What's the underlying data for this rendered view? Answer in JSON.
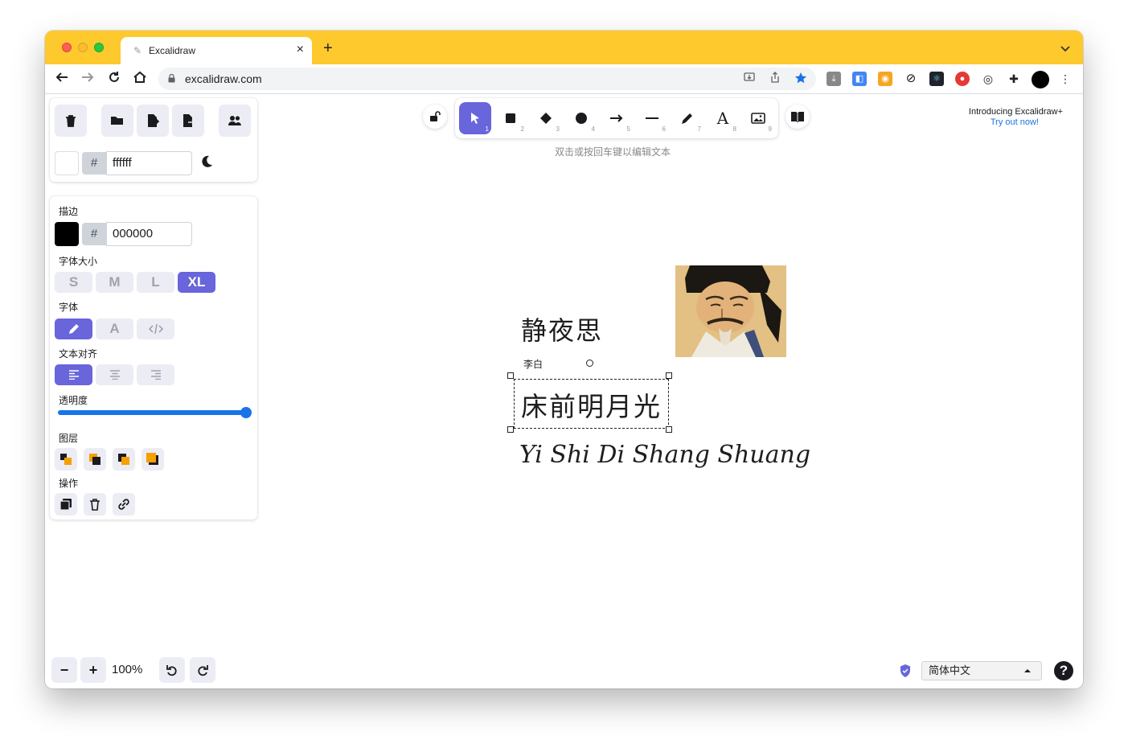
{
  "browser": {
    "tab_title": "Excalidraw",
    "url": "excalidraw.com",
    "tab_bar_color": "#fec92c"
  },
  "left_panel": {
    "background_hex": "ffffff",
    "hash": "#",
    "theme_icon": "moon-icon",
    "stroke": {
      "label": "描边",
      "hex": "000000"
    },
    "font_size": {
      "label": "字体大小",
      "options": [
        "S",
        "M",
        "L",
        "XL"
      ],
      "selected": "XL"
    },
    "font_family": {
      "label": "字体",
      "options": [
        "hand-drawn",
        "A",
        "code"
      ],
      "selected": "hand-drawn"
    },
    "text_align": {
      "label": "文本对齐",
      "selected": "left"
    },
    "opacity": {
      "label": "透明度",
      "value": 100
    },
    "layers": {
      "label": "图层"
    },
    "actions": {
      "label": "操作"
    }
  },
  "toolbar": {
    "tools": [
      {
        "name": "lock",
        "num": ""
      },
      {
        "name": "selection",
        "num": "1"
      },
      {
        "name": "rectangle",
        "num": "2"
      },
      {
        "name": "diamond",
        "num": "3"
      },
      {
        "name": "ellipse",
        "num": "4"
      },
      {
        "name": "arrow",
        "num": "5"
      },
      {
        "name": "line",
        "num": "6"
      },
      {
        "name": "draw",
        "num": "7"
      },
      {
        "name": "text",
        "num": "8"
      },
      {
        "name": "image",
        "num": "9"
      }
    ],
    "selected": "selection",
    "text_tool_glyph": "A",
    "hint": "双击或按回车键以编辑文本"
  },
  "promo": {
    "line1": "Introducing Excalidraw+",
    "line2": "Try out now!"
  },
  "canvas": {
    "title": "静夜思",
    "author": "李白",
    "line1": "床前明月光",
    "pinyin": "Yi Shi Di Shang Shuang"
  },
  "bottom": {
    "zoom": "100%",
    "minus": "−",
    "plus": "+",
    "language": "简体中文",
    "help": "?"
  }
}
